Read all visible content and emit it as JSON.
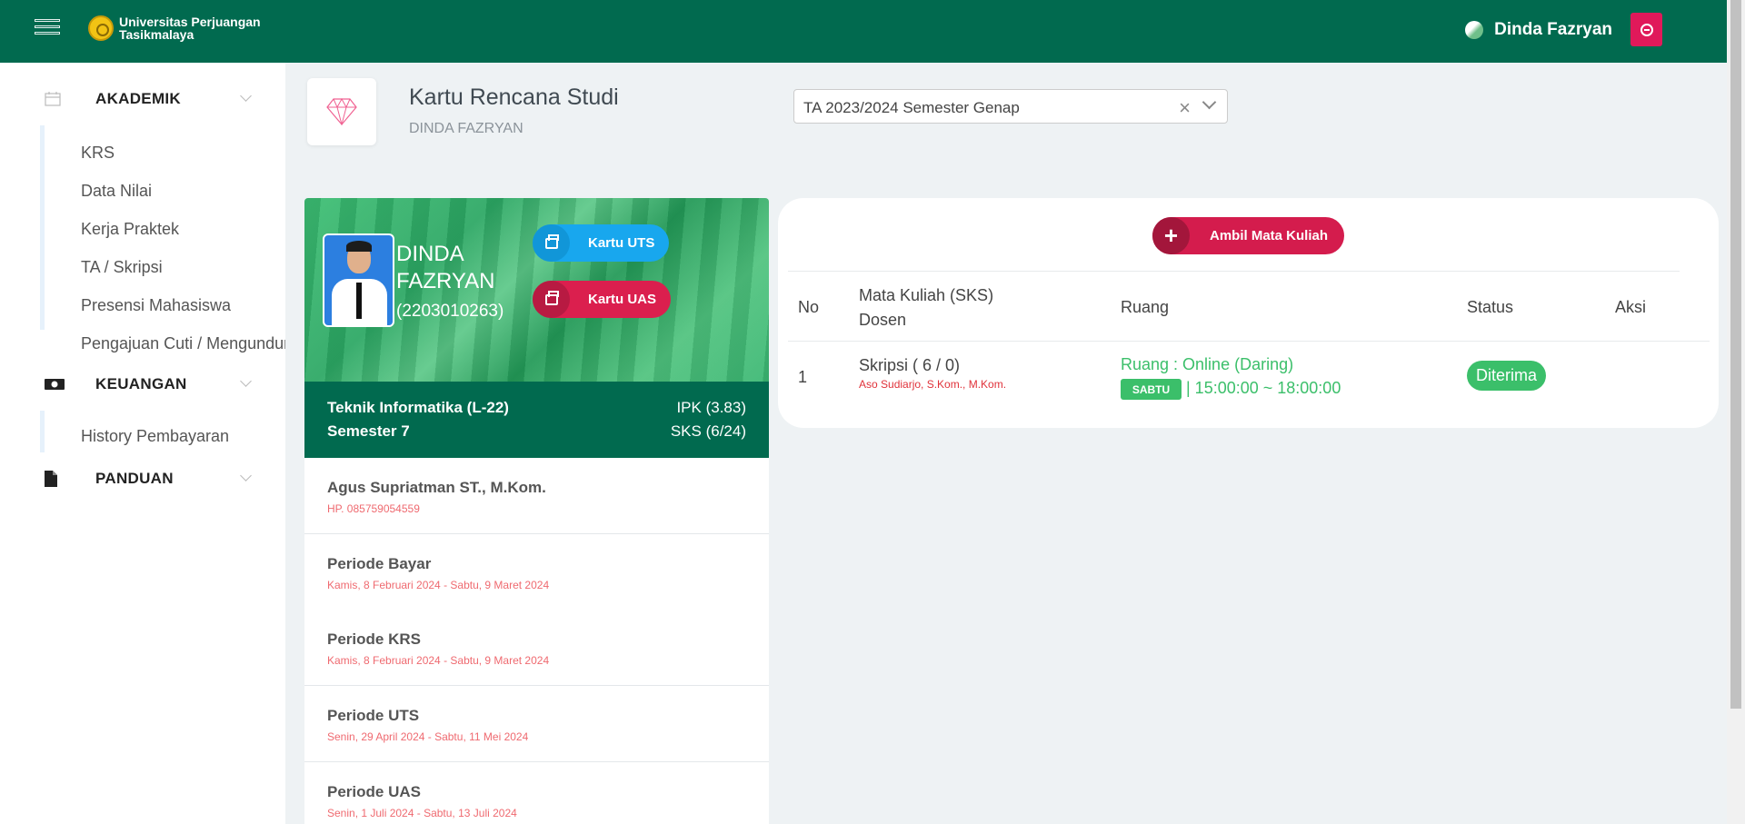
{
  "header": {
    "brand_line1": "Universitas Perjuangan",
    "brand_line2": "Tasikmalaya",
    "user_name": "Dinda Fazryan"
  },
  "sidebar": {
    "sections": [
      {
        "title": "AKADEMIK",
        "icon": "calendar-icon",
        "items": [
          "KRS",
          "Data Nilai",
          "Kerja Praktek",
          "TA / Skripsi",
          "Presensi Mahasiswa",
          "Pengajuan Cuti / Mengundur"
        ]
      },
      {
        "title": "KEUANGAN",
        "icon": "money-icon",
        "items": [
          "History Pembayaran"
        ]
      },
      {
        "title": "PANDUAN",
        "icon": "document-icon",
        "items": []
      }
    ]
  },
  "page": {
    "title": "Kartu Rencana Studi",
    "subtitle": "DINDA FAZRYAN",
    "semester_select": "TA 2023/2024 Semester Genap"
  },
  "profile": {
    "name": "DINDA FAZRYAN",
    "nim": "(2203010263)",
    "btn_uts": "Kartu UTS",
    "btn_uas": "Kartu UAS",
    "prodi": "Teknik Informatika (L-22)",
    "semester": "Semester 7",
    "ipk": "IPK (3.83)",
    "sks": "SKS (6/24)"
  },
  "info": [
    {
      "title": "Agus Supriatman ST., M.Kom.",
      "sub": "HP. 085759054559"
    },
    {
      "title": "Periode Bayar",
      "sub": "Kamis, 8 Februari 2024 - Sabtu, 9 Maret 2024"
    },
    {
      "title": "Periode KRS",
      "sub": "Kamis, 8 Februari 2024 - Sabtu, 9 Maret 2024"
    },
    {
      "title": "Periode UTS",
      "sub": "Senin, 29 April 2024 - Sabtu, 11 Mei 2024"
    },
    {
      "title": "Periode UAS",
      "sub": "Senin, 1 Juli 2024 - Sabtu, 13 Juli 2024"
    }
  ],
  "courses": {
    "add_button": "Ambil Mata Kuliah",
    "headers": {
      "no": "No",
      "mk": "Mata Kuliah (SKS)",
      "dosen": "Dosen",
      "ruang": "Ruang",
      "status": "Status",
      "aksi": "Aksi"
    },
    "rows": [
      {
        "no": "1",
        "mk": "Skripsi ( 6 / 0)",
        "dosen": "Aso Sudiarjo, S.Kom., M.Kom.",
        "ruang": "Ruang : Online (Daring)",
        "hari": "SABTU",
        "jam": "| 15:00:00 ~ 18:00:00",
        "status": "Diterima"
      }
    ]
  },
  "colors": {
    "primary": "#016a4f",
    "accent_red": "#db1f4e",
    "accent_blue": "#18a7ee",
    "success": "#3bbf6a"
  }
}
